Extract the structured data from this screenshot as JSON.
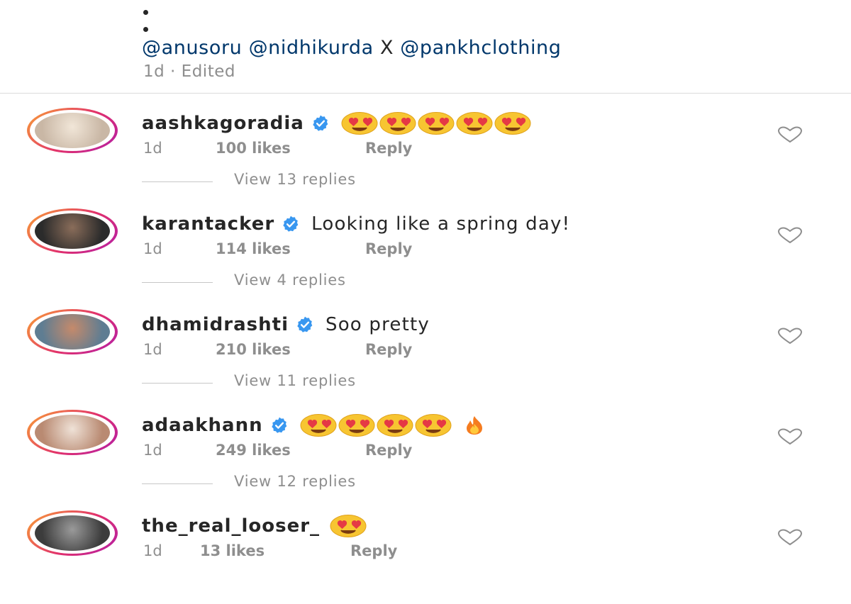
{
  "post": {
    "caption_mentions": [
      "@anusoru",
      "@nidhikurda",
      "X",
      "@pankhclothing"
    ],
    "caption_time": "1d",
    "caption_edited": "Edited"
  },
  "comments": [
    {
      "username": "aashkagoradia",
      "verified": true,
      "text": "",
      "emojis": [
        "heart-eyes-emoji",
        "heart-eyes-emoji",
        "heart-eyes-emoji",
        "heart-eyes-emoji",
        "heart-eyes-emoji"
      ],
      "time": "1d",
      "likes": "100 likes",
      "reply_label": "Reply",
      "view_replies": "View 13 replies",
      "avatar_colors": [
        "#c9b7a5",
        "#f1e6d8"
      ]
    },
    {
      "username": "karantacker",
      "verified": true,
      "text": "Looking like a spring day!",
      "emojis": [],
      "time": "1d",
      "likes": "114 likes",
      "reply_label": "Reply",
      "view_replies": "View 4 replies",
      "avatar_colors": [
        "#2b2b2b",
        "#8a6d5a"
      ]
    },
    {
      "username": "dhamidrashti",
      "verified": true,
      "text": "Soo pretty",
      "emojis": [],
      "time": "1d",
      "likes": "210 likes",
      "reply_label": "Reply",
      "view_replies": "View 11 replies",
      "avatar_colors": [
        "#5f7d92",
        "#c58a6b"
      ]
    },
    {
      "username": "adaakhann",
      "verified": true,
      "text": "",
      "emojis": [
        "heart-eyes-emoji",
        "heart-eyes-emoji",
        "heart-eyes-emoji",
        "heart-eyes-emoji",
        "fire-emoji"
      ],
      "time": "1d",
      "likes": "249 likes",
      "reply_label": "Reply",
      "view_replies": "View 12 replies",
      "avatar_colors": [
        "#b98a72",
        "#efe2d7"
      ]
    },
    {
      "username": "the_real_looser_",
      "verified": false,
      "text": "",
      "emojis": [
        "heart-eyes-emoji"
      ],
      "time": "1d",
      "likes": "13 likes",
      "reply_label": "Reply",
      "view_replies": "",
      "avatar_colors": [
        "#3c3c3c",
        "#9a9a9a"
      ]
    }
  ],
  "colors": {
    "mention": "#00376b",
    "meta_gray": "#8e8e8e",
    "verified_blue": "#3897f0",
    "story_ring_start": "#f9a334",
    "story_ring_end": "#b21ea8"
  }
}
